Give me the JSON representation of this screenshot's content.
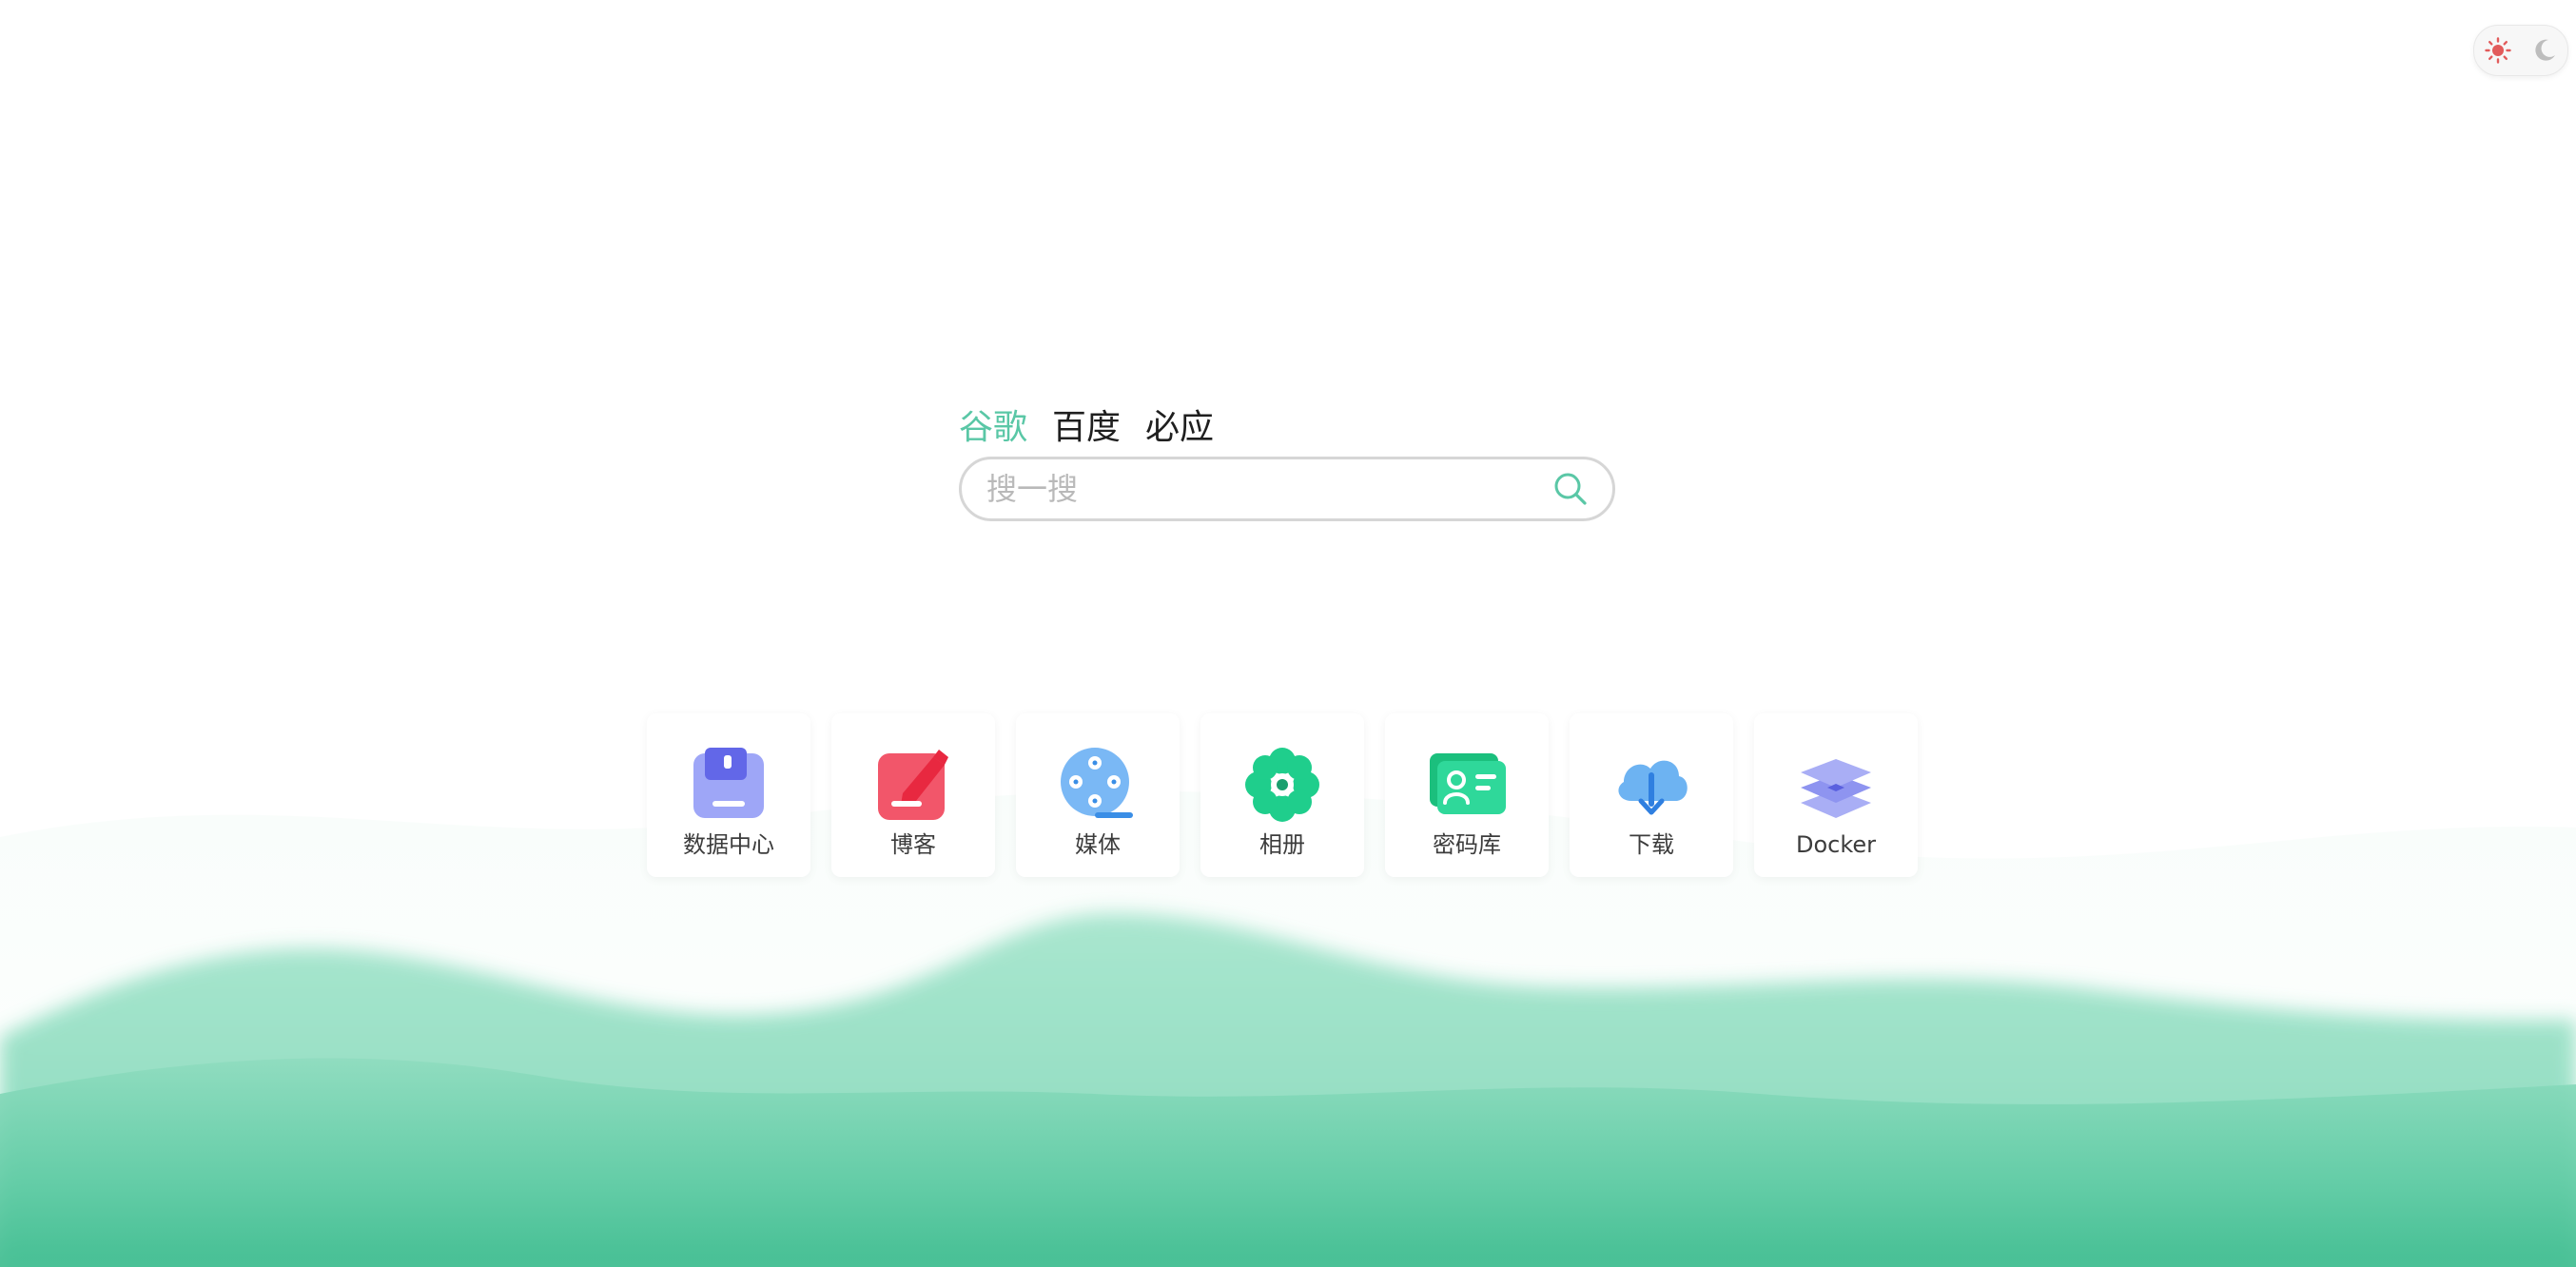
{
  "theme_toggle": {
    "light_icon": "sun-icon",
    "dark_icon": "moon-icon",
    "active": "light"
  },
  "search": {
    "engines": [
      {
        "label": "谷歌",
        "active": true
      },
      {
        "label": "百度",
        "active": false
      },
      {
        "label": "必应",
        "active": false
      }
    ],
    "placeholder": "搜一搜",
    "value": "",
    "button_icon": "search-icon"
  },
  "apps": [
    {
      "label": "数据中心",
      "icon": "storage-icon"
    },
    {
      "label": "博客",
      "icon": "edit-icon"
    },
    {
      "label": "媒体",
      "icon": "film-reel-icon"
    },
    {
      "label": "相册",
      "icon": "flower-icon"
    },
    {
      "label": "密码库",
      "icon": "id-card-icon"
    },
    {
      "label": "下载",
      "icon": "cloud-download-icon"
    },
    {
      "label": "Docker",
      "icon": "layers-icon"
    }
  ],
  "colors": {
    "accent": "#5ac7a6",
    "wave_dark": "#3dbf94",
    "wave_light": "#a9e6cf"
  }
}
